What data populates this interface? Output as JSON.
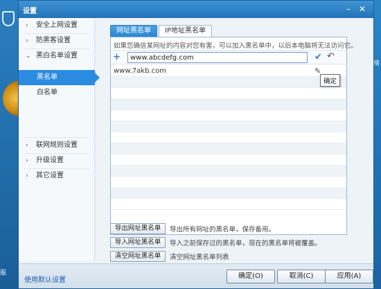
{
  "window": {
    "title": "设置"
  },
  "background": {
    "net_label": "网络",
    "mini_label": "服"
  },
  "sidebar": {
    "items": [
      {
        "label": "安全上网设置"
      },
      {
        "label": "防黑客设置"
      },
      {
        "label": "黑白名单设置"
      },
      {
        "label": "黑名单"
      },
      {
        "label": "白名单"
      },
      {
        "label": "联网规则设置"
      },
      {
        "label": "升级设置"
      },
      {
        "label": "其它设置"
      }
    ]
  },
  "tabs": [
    {
      "label": "网址黑名单"
    },
    {
      "label": "IP地址黑名单"
    }
  ],
  "panel": {
    "hint": "如果您确信某网址的内容对您有害，可以加入黑名单中，以后本电脑将无法访问它。",
    "input_value": "www.abcdefg.com",
    "entries": [
      "www.7akb.com",
      "",
      "",
      "",
      "",
      "",
      "",
      "",
      "",
      "",
      "",
      "",
      ""
    ],
    "tooltip": "确定"
  },
  "actions": [
    {
      "button": "导出网址黑名单",
      "desc": "导出所有网址的黑名单，保存备用。"
    },
    {
      "button": "导入网址黑名单",
      "desc": "导入之前保存过的黑名单，现在的黑名单将被覆盖。"
    },
    {
      "button": "清空网址黑名单",
      "desc": "清空网址黑名单列表"
    }
  ],
  "footer": {
    "default_link": "使用默认设置",
    "ok": "确定(O)",
    "cancel": "取消(C)",
    "apply": "应用(A)"
  },
  "icons": [
    "plus-icon",
    "check-icon",
    "undo-icon",
    "pencil-icon",
    "minimize-icon",
    "close-icon",
    "chevron-right-icon",
    "chevron-down-icon"
  ]
}
